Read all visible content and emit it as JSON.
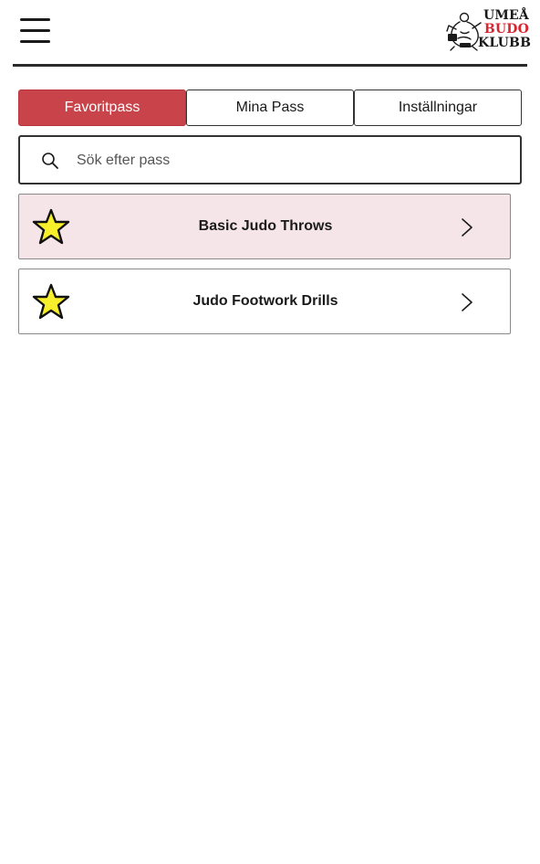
{
  "header": {
    "menu_icon": "hamburger-menu-icon",
    "logo": {
      "line_1": "UMEÅ",
      "line_2": "BUDO",
      "line_3": "KLUBB",
      "colors": {
        "primary": "#1a1a1a",
        "accent": "#d7262f"
      }
    }
  },
  "tabs": [
    {
      "label": "Favoritpass",
      "active": true
    },
    {
      "label": "Mina Pass",
      "active": false
    },
    {
      "label": "Inställningar",
      "active": false
    }
  ],
  "search": {
    "icon": "search-icon",
    "placeholder": "Sök efter pass",
    "value": ""
  },
  "sessions": [
    {
      "title": "Basic Judo Throws",
      "favorite": true,
      "icon": "star-icon"
    },
    {
      "title": "Judo Footwork Drills",
      "favorite": true,
      "icon": "star-icon"
    }
  ],
  "colors": {
    "tab_active_bg": "#c8434a",
    "highlight_row_bg": "#f6e5e8",
    "star_fill": "#f7ef2c"
  }
}
